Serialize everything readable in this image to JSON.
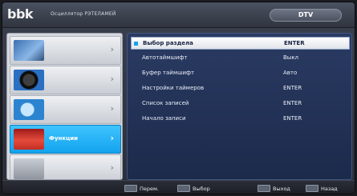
{
  "topbar": {
    "logo": "bbk",
    "title": "Осциллятор РЭТЕЛАМЕЙ",
    "source": "DTV"
  },
  "sidebar": {
    "items": [
      {
        "label": "",
        "icon": "picture-icon",
        "active": false
      },
      {
        "label": "",
        "icon": "sound-icon",
        "active": false
      },
      {
        "label": "",
        "icon": "setup-icon",
        "active": false
      },
      {
        "label": "Функции",
        "icon": "function-icon",
        "active": true
      },
      {
        "label": "",
        "icon": "lock-icon",
        "active": false
      }
    ]
  },
  "panel": {
    "rows": [
      {
        "label": "Выбор раздела",
        "value": "ENTER",
        "selected": true
      },
      {
        "label": "Автотаймшифт",
        "value": "Выкл",
        "selected": false
      },
      {
        "label": "Буфер таймшифт",
        "value": "Авто",
        "selected": false
      },
      {
        "label": "Настройки таймеров",
        "value": "ENTER",
        "selected": false
      },
      {
        "label": "Список записей",
        "value": "ENTER",
        "selected": false
      },
      {
        "label": "Начало записи",
        "value": "ENTER",
        "selected": false
      }
    ]
  },
  "hints": {
    "move_key": "",
    "move_label": "Перем.",
    "select_key": "",
    "select_label": "Выбор",
    "exit_key": "",
    "exit_label": "Выход",
    "back_key": "",
    "back_label": "Назад"
  },
  "colors": {
    "accent": "#13a3ee",
    "panel_bg": "#22325a",
    "sidebar_bg": "#d5d8dd"
  }
}
